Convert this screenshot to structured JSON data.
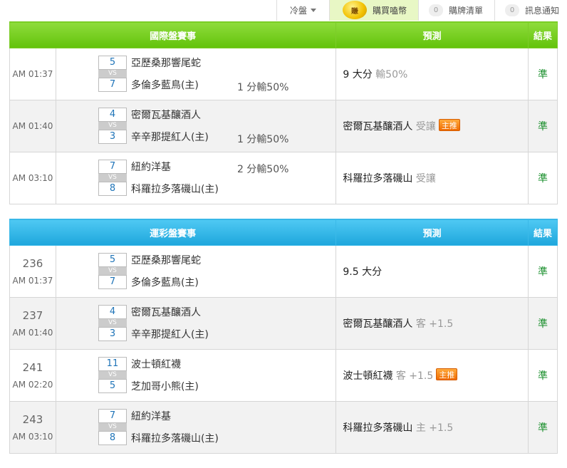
{
  "topbar": {
    "cold_label": "冷盤",
    "coin_text": "賺",
    "buy_label": "購買嗑幣",
    "list_count": "0",
    "list_label": "購牌清單",
    "msg_count": "0",
    "msg_label": "訊息通知"
  },
  "intl": {
    "header": {
      "match": "國際盤賽事",
      "pred": "預測",
      "result": "結果"
    },
    "rows": [
      {
        "time": "AM 01:37",
        "s1": "5",
        "s2": "7",
        "team1": "亞歷桑那響尾蛇",
        "team2": "多倫多藍鳥(主)",
        "hcp": "1 分輸50%",
        "pred": "9 大分",
        "pred_sub": "輸50%",
        "result": "準"
      },
      {
        "time": "AM 01:40",
        "s1": "4",
        "s2": "3",
        "team1": "密爾瓦基釀酒人",
        "team2": "辛辛那提紅人(主)",
        "hcp": "1 分輸50%",
        "pred": "密爾瓦基釀酒人",
        "pred_sub": "受讓",
        "hot": "主推",
        "result": "準"
      },
      {
        "time": "AM 03:10",
        "s1": "7",
        "s2": "8",
        "team1": "紐約洋基",
        "team2": "科羅拉多落磯山(主)",
        "hcp": "2 分輸50%",
        "pred": "科羅拉多落磯山",
        "pred_sub": "受讓",
        "result": "準"
      }
    ]
  },
  "sport": {
    "header": {
      "match": "運彩盤賽事",
      "pred": "預測",
      "result": "結果"
    },
    "rows": [
      {
        "num": "236",
        "time": "AM 01:37",
        "s1": "5",
        "s2": "7",
        "team1": "亞歷桑那響尾蛇",
        "team2": "多倫多藍鳥(主)",
        "pred": "9.5 大分",
        "pred_sub": "",
        "result": "準"
      },
      {
        "num": "237",
        "time": "AM 01:40",
        "s1": "4",
        "s2": "3",
        "team1": "密爾瓦基釀酒人",
        "team2": "辛辛那提紅人(主)",
        "pred": "密爾瓦基釀酒人",
        "pred_sub": "客 +1.5",
        "result": "準"
      },
      {
        "num": "241",
        "time": "AM 02:20",
        "s1": "11",
        "s2": "5",
        "team1": "波士頓紅襪",
        "team2": "芝加哥小熊(主)",
        "pred": "波士頓紅襪",
        "pred_sub": "客 +1.5",
        "hot": "主推",
        "result": "準"
      },
      {
        "num": "243",
        "time": "AM 03:10",
        "s1": "7",
        "s2": "8",
        "team1": "紐約洋基",
        "team2": "科羅拉多落磯山(主)",
        "pred": "科羅拉多落磯山",
        "pred_sub": "主 +1.5",
        "result": "準"
      }
    ]
  },
  "vs_label": "VS"
}
